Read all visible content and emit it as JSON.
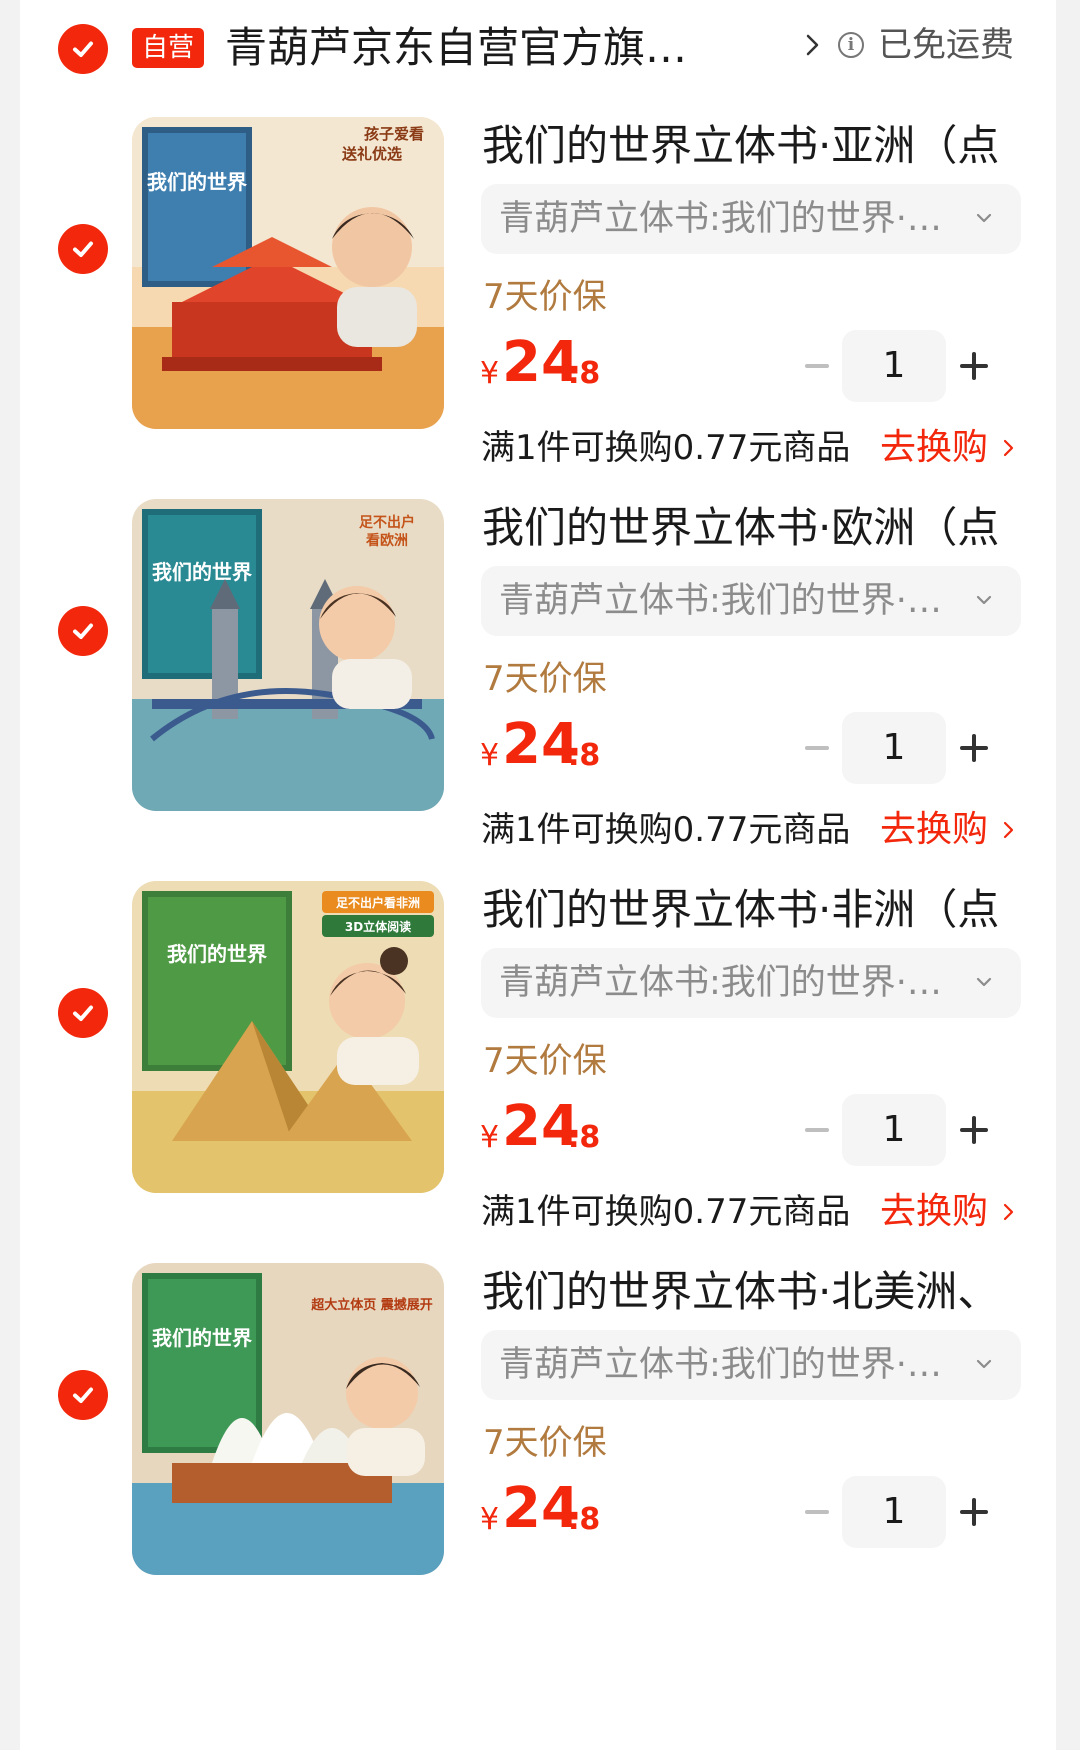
{
  "store": {
    "badge": "自营",
    "name": "青葫芦京东自营官方旗…",
    "shipping": "已免运费"
  },
  "items": [
    {
      "title": "我们的世界立体书·亚洲（点",
      "spec": "青葫芦立体书:我们的世界·…",
      "guarantee": "7天价保",
      "currency": "¥",
      "price_int": "24",
      "price_dec": ".8",
      "quantity": "1",
      "promo": "满1件可换购0.77元商品",
      "promo_link": "去换购",
      "image": {
        "banner": "孩子爱看送礼优选",
        "book_title": "我们的世界",
        "landmark": "tiananmen"
      }
    },
    {
      "title": "我们的世界立体书·欧洲（点",
      "spec": "青葫芦立体书:我们的世界·…",
      "guarantee": "7天价保",
      "currency": "¥",
      "price_int": "24",
      "price_dec": ".8",
      "quantity": "1",
      "promo": "满1件可换购0.77元商品",
      "promo_link": "去换购",
      "image": {
        "banner": "足不出户看欧洲",
        "book_title": "我们的世界",
        "landmark": "tower-bridge"
      }
    },
    {
      "title": "我们的世界立体书·非洲（点",
      "spec": "青葫芦立体书:我们的世界·…",
      "guarantee": "7天价保",
      "currency": "¥",
      "price_int": "24",
      "price_dec": ".8",
      "quantity": "1",
      "promo": "满1件可换购0.77元商品",
      "promo_link": "去换购",
      "image": {
        "banner": "足不出户看非洲 3D立体阅读",
        "book_title": "我们的世界",
        "landmark": "pyramids"
      }
    },
    {
      "title": "我们的世界立体书·北美洲、",
      "spec": "青葫芦立体书:我们的世界·…",
      "guarantee": "7天价保",
      "currency": "¥",
      "price_int": "24",
      "price_dec": ".8",
      "quantity": "1",
      "image": {
        "banner": "超大立体页 震撼展开",
        "book_title": "我们的世界",
        "landmark": "sydney-opera-house"
      }
    }
  ],
  "colors": {
    "accent": "#f2270c",
    "guarantee": "#b17a3f",
    "muted": "#8c8c8c"
  }
}
